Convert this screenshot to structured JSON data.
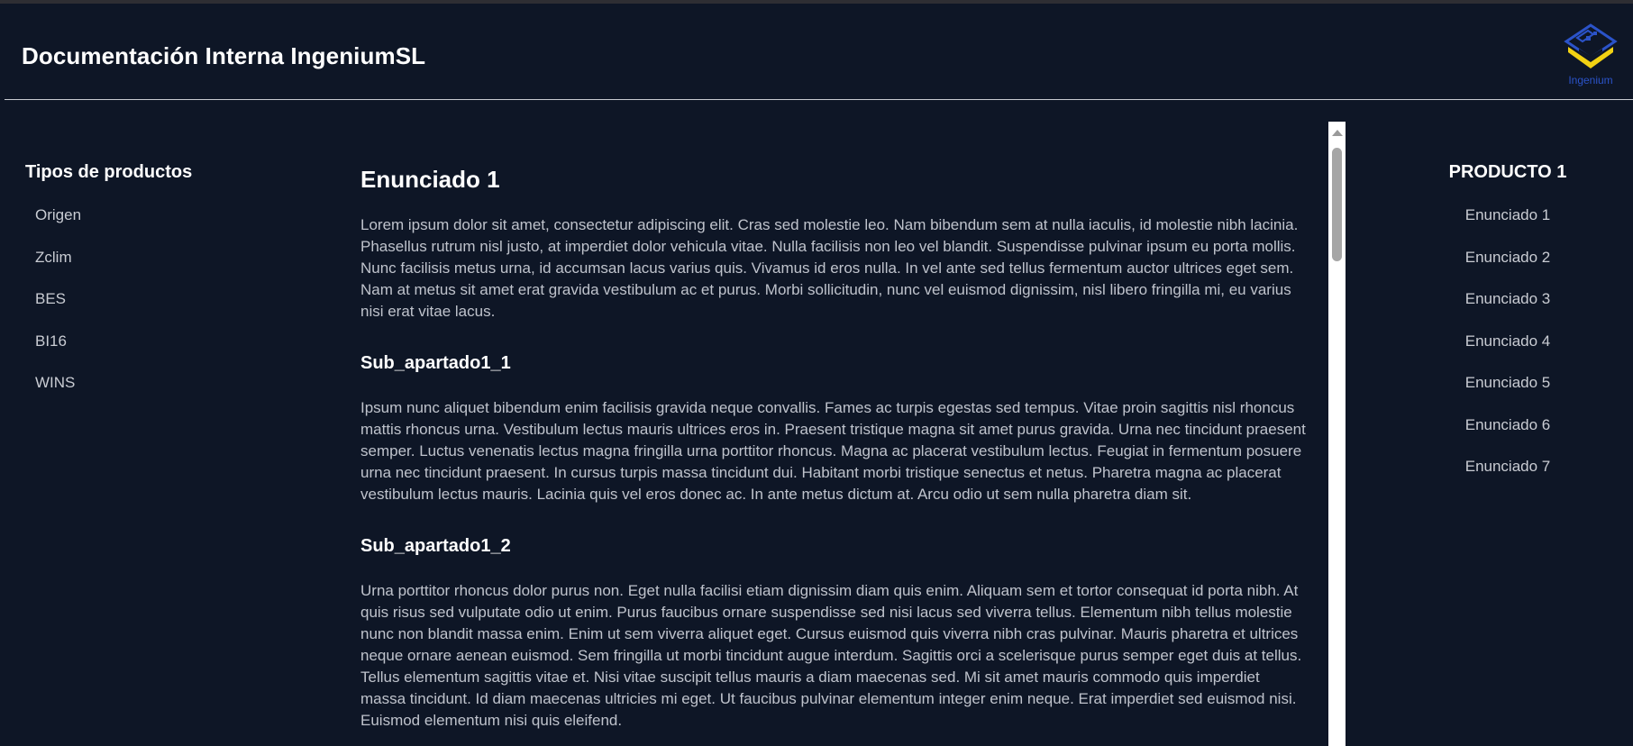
{
  "header": {
    "title": "Documentación Interna IngeniumSL",
    "logo_text": "Ingenium"
  },
  "colors": {
    "background": "#0e1626",
    "logo_blue": "#2b53c9",
    "logo_yellow": "#f2d213"
  },
  "sidebar": {
    "title": "Tipos de productos",
    "items": [
      {
        "label": "Origen"
      },
      {
        "label": "Zclim"
      },
      {
        "label": "BES"
      },
      {
        "label": "BI16"
      },
      {
        "label": "WINS"
      }
    ]
  },
  "content": {
    "heading": "Enunciado 1",
    "paragraph1": "Lorem ipsum dolor sit amet, consectetur adipiscing elit. Cras sed molestie leo. Nam bibendum sem at nulla iaculis, id molestie nibh lacinia. Phasellus rutrum nisl justo, at imperdiet dolor vehicula vitae. Nulla facilisis non leo vel blandit. Suspendisse pulvinar ipsum eu porta mollis. Nunc facilisis metus urna, id accumsan lacus varius quis. Vivamus id eros nulla. In vel ante sed tellus fermentum auctor ultrices eget sem. Nam at metus sit amet erat gravida vestibulum ac et purus. Morbi sollicitudin, nunc vel euismod dignissim, nisl libero fringilla mi, eu varius nisi erat vitae lacus.",
    "sub1": {
      "heading": "Sub_apartado1_1",
      "text": "Ipsum nunc aliquet bibendum enim facilisis gravida neque convallis. Fames ac turpis egestas sed tempus. Vitae proin sagittis nisl rhoncus mattis rhoncus urna. Vestibulum lectus mauris ultrices eros in. Praesent tristique magna sit amet purus gravida. Urna nec tincidunt praesent semper. Luctus venenatis lectus magna fringilla urna porttitor rhoncus. Magna ac placerat vestibulum lectus. Feugiat in fermentum posuere urna nec tincidunt praesent. In cursus turpis massa tincidunt dui. Habitant morbi tristique senectus et netus. Pharetra magna ac placerat vestibulum lectus mauris. Lacinia quis vel eros donec ac. In ante metus dictum at. Arcu odio ut sem nulla pharetra diam sit."
    },
    "sub2": {
      "heading": "Sub_apartado1_2",
      "text": "Urna porttitor rhoncus dolor purus non. Eget nulla facilisi etiam dignissim diam quis enim. Aliquam sem et tortor consequat id porta nibh. At quis risus sed vulputate odio ut enim. Purus faucibus ornare suspendisse sed nisi lacus sed viverra tellus. Elementum nibh tellus molestie nunc non blandit massa enim. Enim ut sem viverra aliquet eget. Cursus euismod quis viverra nibh cras pulvinar. Mauris pharetra et ultrices neque ornare aenean euismod. Sem fringilla ut morbi tincidunt augue interdum. Sagittis orci a scelerisque purus semper eget duis at tellus. Tellus elementum sagittis vitae et. Nisi vitae suscipit tellus mauris a diam maecenas sed. Mi sit amet mauris commodo quis imperdiet massa tincidunt. Id diam maecenas ultricies mi eget. Ut faucibus pulvinar elementum integer enim neque. Erat imperdiet sed euismod nisi. Euismod elementum nisi quis eleifend."
    }
  },
  "rightnav": {
    "title": "PRODUCTO 1",
    "items": [
      {
        "label": "Enunciado 1"
      },
      {
        "label": "Enunciado 2"
      },
      {
        "label": "Enunciado 3"
      },
      {
        "label": "Enunciado 4"
      },
      {
        "label": "Enunciado 5"
      },
      {
        "label": "Enunciado 6"
      },
      {
        "label": "Enunciado 7"
      }
    ]
  }
}
